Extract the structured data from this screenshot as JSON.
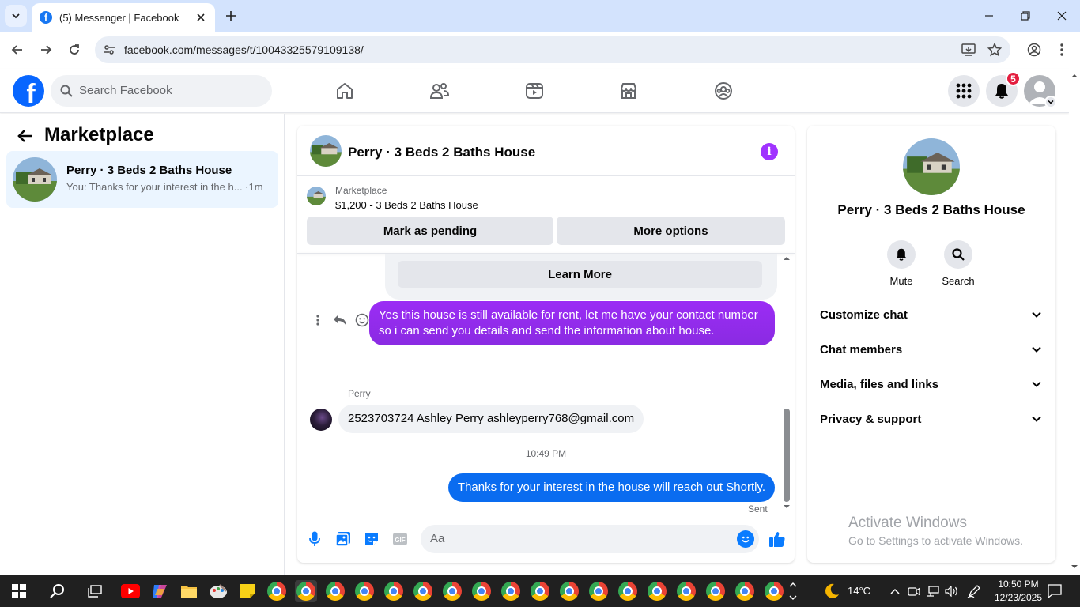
{
  "browser": {
    "tab_title": "(5) Messenger | Facebook",
    "url": "facebook.com/messages/t/10043325579109138/"
  },
  "fb": {
    "logo": "f",
    "search_placeholder": "Search Facebook",
    "notification_count": "5",
    "nav_icons": [
      "home-icon",
      "friends-icon",
      "video-icon",
      "marketplace-icon",
      "groups-icon"
    ]
  },
  "left": {
    "title": "Marketplace",
    "conversation": {
      "name": "Perry · 3 Beds 2 Baths House",
      "preview": "You: Thanks for your interest in the h... ·1m"
    }
  },
  "chat": {
    "header_name": "Perry · 3 Beds 2 Baths House",
    "marketplace_label": "Marketplace",
    "listing_title": "$1,200 - 3 Beds 2 Baths House",
    "mark_pending": "Mark as pending",
    "more_options": "More options",
    "learn_more": "Learn More",
    "messages": {
      "out1": "Yes this house is still available for rent, let me have your contact number so i can send you details and send the information about house.",
      "sender": "Perry",
      "in1": "2523703724 Ashley Perry ashleyperry768@gmail.com",
      "timestamp": "10:49 PM",
      "out2": "Thanks for your interest in the house will reach out Shortly.",
      "status": "Sent"
    },
    "composer_placeholder": "Aa"
  },
  "right": {
    "name": "Perry · 3 Beds 2 Baths House",
    "actions": [
      {
        "label": "Mute"
      },
      {
        "label": "Search"
      }
    ],
    "sections": [
      "Customize chat",
      "Chat members",
      "Media, files and links",
      "Privacy & support"
    ]
  },
  "watermark": {
    "line1": "Activate Windows",
    "line2": "Go to Settings to activate Windows."
  },
  "taskbar": {
    "weather": "14°C",
    "time": "10:50 PM",
    "date": "12/23/2025"
  },
  "colors": {
    "fb_blue": "#0866ff",
    "bubble_purple": "#9b2cf5",
    "bubble_blue": "#0a6cf0",
    "selected_conv": "#ebf5ff"
  }
}
